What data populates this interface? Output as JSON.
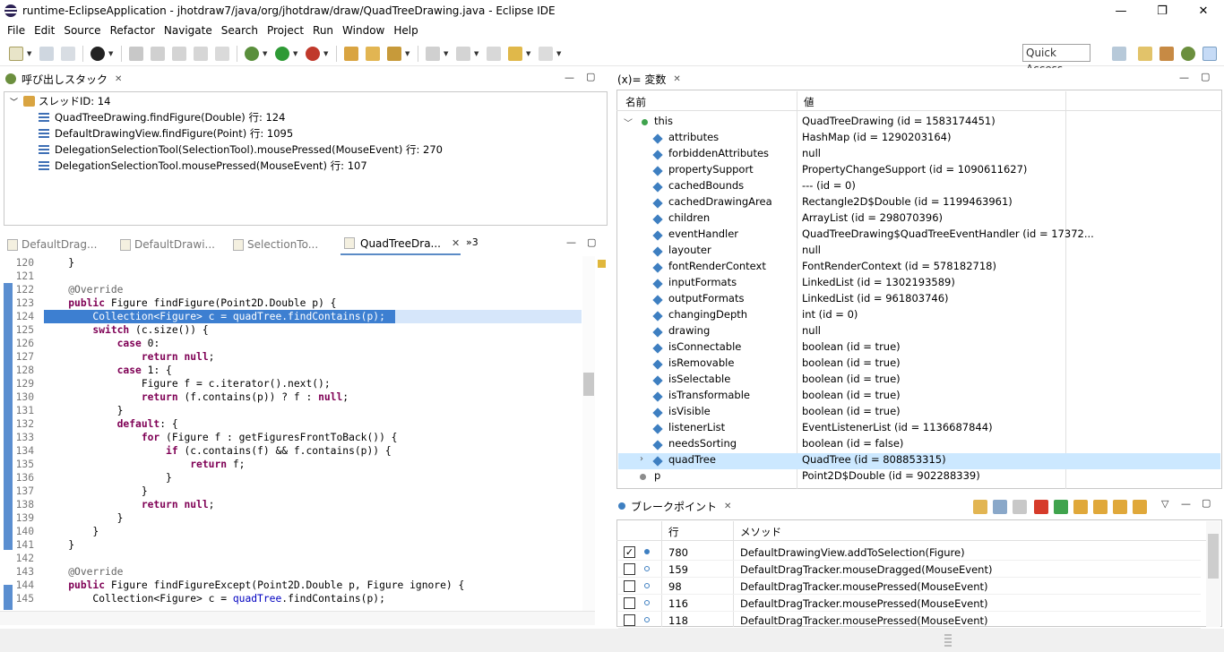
{
  "window": {
    "title": "runtime-EclipseApplication - jhotdraw7/java/org/jhotdraw/draw/QuadTreeDrawing.java - Eclipse IDE",
    "minimize": "—",
    "restore": "❐",
    "close": "✕"
  },
  "menu": [
    "File",
    "Edit",
    "Source",
    "Refactor",
    "Navigate",
    "Search",
    "Project",
    "Run",
    "Window",
    "Help"
  ],
  "toolbar": {
    "quick_access": "Quick Access"
  },
  "call_stack": {
    "tab_label": "呼び出しスタック",
    "thread": "スレッドID: 14",
    "frames": [
      "QuadTreeDrawing.findFigure(Double) 行: 124",
      "DefaultDrawingView.findFigure(Point) 行: 1095",
      "DelegationSelectionTool(SelectionTool).mousePressed(MouseEvent) 行: 270",
      "DelegationSelectionTool.mousePressed(MouseEvent) 行: 107"
    ]
  },
  "editor": {
    "tabs": [
      "DefaultDrag...",
      "DefaultDrawi...",
      "SelectionTo...",
      "QuadTreeDra..."
    ],
    "overflow": "»3",
    "lines": [
      {
        "n": "120",
        "t": "    }"
      },
      {
        "n": "121",
        "t": ""
      },
      {
        "n": "122",
        "t": "    @Override"
      },
      {
        "n": "123",
        "t": "    public Figure findFigure(Point2D.Double p) {"
      },
      {
        "n": "124",
        "t": "        Collection<Figure> c = quadTree.findContains(p);"
      },
      {
        "n": "125",
        "t": "        switch (c.size()) {"
      },
      {
        "n": "126",
        "t": "            case 0:"
      },
      {
        "n": "127",
        "t": "                return null;"
      },
      {
        "n": "128",
        "t": "            case 1: {"
      },
      {
        "n": "129",
        "t": "                Figure f = c.iterator().next();"
      },
      {
        "n": "130",
        "t": "                return (f.contains(p)) ? f : null;"
      },
      {
        "n": "131",
        "t": "            }"
      },
      {
        "n": "132",
        "t": "            default: {"
      },
      {
        "n": "133",
        "t": "                for (Figure f : getFiguresFrontToBack()) {"
      },
      {
        "n": "134",
        "t": "                    if (c.contains(f) && f.contains(p)) {"
      },
      {
        "n": "135",
        "t": "                        return f;"
      },
      {
        "n": "136",
        "t": "                    }"
      },
      {
        "n": "137",
        "t": "                }"
      },
      {
        "n": "138",
        "t": "                return null;"
      },
      {
        "n": "139",
        "t": "            }"
      },
      {
        "n": "140",
        "t": "        }"
      },
      {
        "n": "141",
        "t": "    }"
      },
      {
        "n": "142",
        "t": ""
      },
      {
        "n": "143",
        "t": "    @Override"
      },
      {
        "n": "144",
        "t": "    public Figure findFigureExcept(Point2D.Double p, Figure ignore) {"
      },
      {
        "n": "145",
        "t": "        Collection<Figure> c = quadTree.findContains(p);"
      }
    ]
  },
  "variables": {
    "tab_label": "(x)= 変数",
    "col_name": "名前",
    "col_value": "値",
    "rows": [
      {
        "name": "this",
        "value": "QuadTreeDrawing (id = 1583174451)"
      },
      {
        "name": "attributes",
        "value": "HashMap (id = 1290203164)"
      },
      {
        "name": "forbiddenAttributes",
        "value": "null"
      },
      {
        "name": "propertySupport",
        "value": "PropertyChangeSupport (id = 1090611627)"
      },
      {
        "name": "cachedBounds",
        "value": "--- (id = 0)"
      },
      {
        "name": "cachedDrawingArea",
        "value": "Rectangle2D$Double (id = 1199463961)"
      },
      {
        "name": "children",
        "value": "ArrayList (id = 298070396)"
      },
      {
        "name": "eventHandler",
        "value": "QuadTreeDrawing$QuadTreeEventHandler (id = 17372..."
      },
      {
        "name": "layouter",
        "value": "null"
      },
      {
        "name": "fontRenderContext",
        "value": "FontRenderContext (id = 578182718)"
      },
      {
        "name": "inputFormats",
        "value": "LinkedList (id = 1302193589)"
      },
      {
        "name": "outputFormats",
        "value": "LinkedList (id = 961803746)"
      },
      {
        "name": "changingDepth",
        "value": "int (id = 0)"
      },
      {
        "name": "drawing",
        "value": "null"
      },
      {
        "name": "isConnectable",
        "value": "boolean (id = true)"
      },
      {
        "name": "isRemovable",
        "value": "boolean (id = true)"
      },
      {
        "name": "isSelectable",
        "value": "boolean (id = true)"
      },
      {
        "name": "isTransformable",
        "value": "boolean (id = true)"
      },
      {
        "name": "isVisible",
        "value": "boolean (id = true)"
      },
      {
        "name": "listenerList",
        "value": "EventListenerList (id = 1136687844)"
      },
      {
        "name": "needsSorting",
        "value": "boolean (id = false)"
      },
      {
        "name": "quadTree",
        "value": "QuadTree (id = 808853315)"
      },
      {
        "name": "p",
        "value": "Point2D$Double (id = 902288339)"
      }
    ]
  },
  "breakpoints": {
    "tab_label": "ブレークポイント",
    "col_line": "行",
    "col_method": "メソッド",
    "rows": [
      {
        "line": "780",
        "method": "DefaultDrawingView.addToSelection(Figure)",
        "checked": true
      },
      {
        "line": "159",
        "method": "DefaultDragTracker.mouseDragged(MouseEvent)",
        "checked": false
      },
      {
        "line": "98",
        "method": "DefaultDragTracker.mousePressed(MouseEvent)",
        "checked": false
      },
      {
        "line": "116",
        "method": "DefaultDragTracker.mousePressed(MouseEvent)",
        "checked": false
      },
      {
        "line": "118",
        "method": "DefaultDragTracker.mousePressed(MouseEvent)",
        "checked": false
      }
    ]
  },
  "colors": {
    "selection": "#cce8ff",
    "current_line": "#c6dbf6",
    "keyword": "#7f0055",
    "annotation": "#646464",
    "field": "#0000c0"
  }
}
